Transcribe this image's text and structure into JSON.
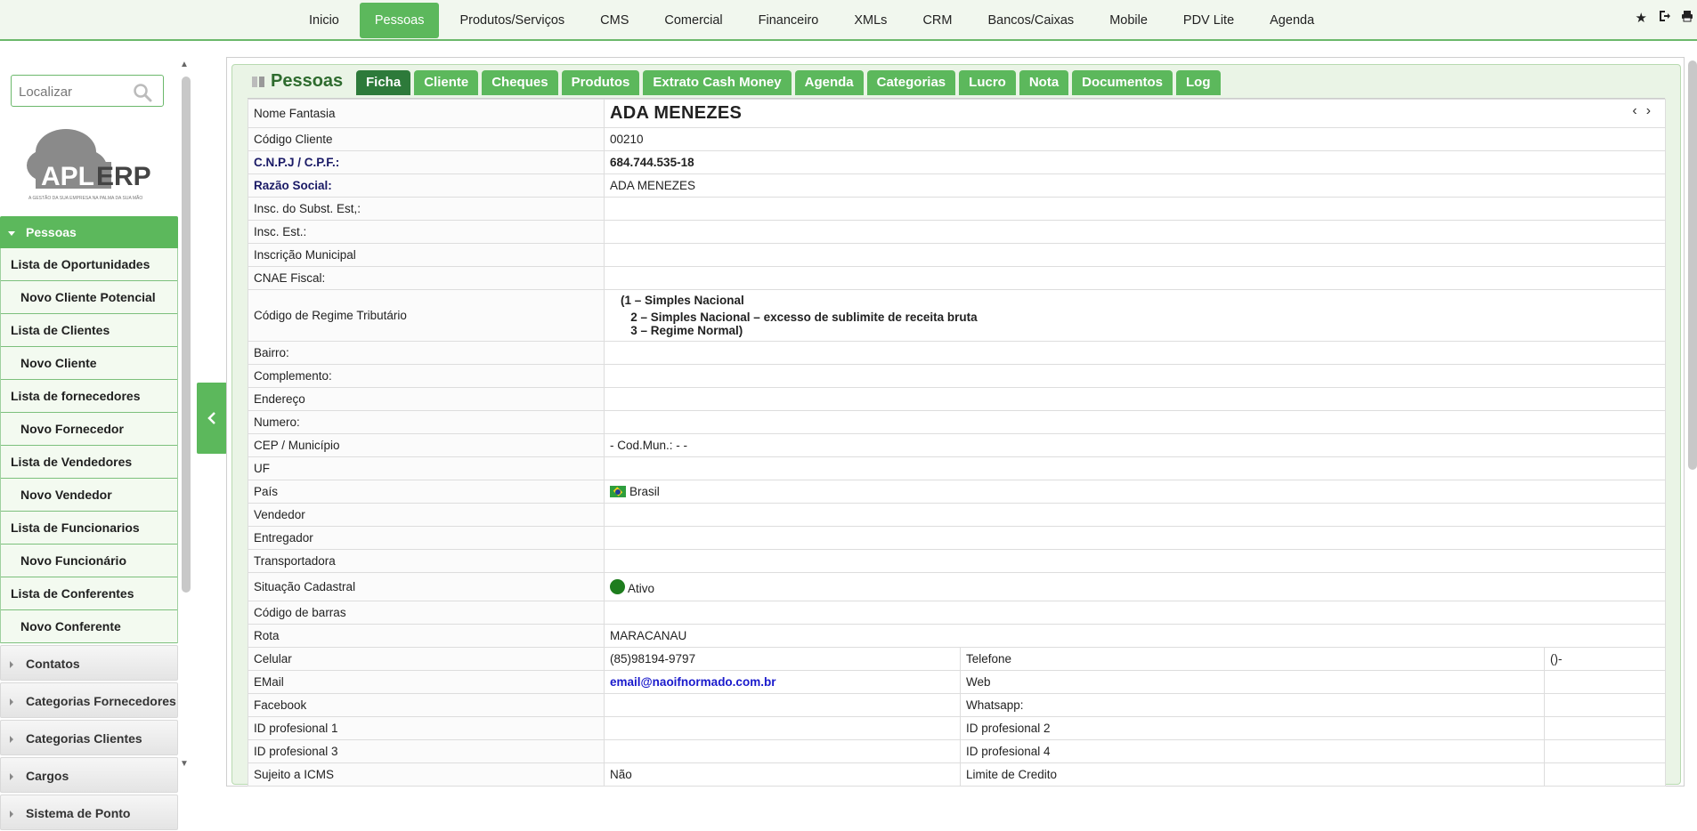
{
  "topmenu": {
    "items": [
      {
        "label": "Inicio"
      },
      {
        "label": "Pessoas",
        "active": true
      },
      {
        "label": "Produtos/Serviços"
      },
      {
        "label": "CMS"
      },
      {
        "label": "Comercial"
      },
      {
        "label": "Financeiro"
      },
      {
        "label": "XMLs"
      },
      {
        "label": "CRM"
      },
      {
        "label": "Bancos/Caixas"
      },
      {
        "label": "Mobile"
      },
      {
        "label": "PDV Lite"
      },
      {
        "label": "Agenda"
      }
    ],
    "icons": [
      "star-icon",
      "logout-icon",
      "print-icon"
    ]
  },
  "sidebar": {
    "search_placeholder": "Localizar",
    "logo_text": "APL ERP",
    "logo_tagline": "A GESTÃO DA SUA EMPRESA NA PALMA DA SUA MÃO",
    "active_section": "Pessoas",
    "items": [
      {
        "label": "Lista de Oportunidades",
        "indent": false
      },
      {
        "label": "Novo Cliente Potencial",
        "indent": true
      },
      {
        "label": "Lista de Clientes",
        "indent": false
      },
      {
        "label": "Novo Cliente",
        "indent": true
      },
      {
        "label": "Lista de fornecedores",
        "indent": false
      },
      {
        "label": "Novo Fornecedor",
        "indent": true
      },
      {
        "label": "Lista de Vendedores",
        "indent": false
      },
      {
        "label": "Novo Vendedor",
        "indent": true
      },
      {
        "label": "Lista de Funcionarios",
        "indent": false
      },
      {
        "label": "Novo Funcionário",
        "indent": true
      },
      {
        "label": "Lista de Conferentes",
        "indent": false
      },
      {
        "label": "Novo Conferente",
        "indent": true
      }
    ],
    "groups": [
      "Contatos",
      "Categorias Fornecedores",
      "Categorias Clientes",
      "Cargos",
      "Sistema de Ponto"
    ]
  },
  "panel": {
    "title": "Pessoas",
    "tabs": [
      {
        "label": "Ficha",
        "active": true
      },
      {
        "label": "Cliente"
      },
      {
        "label": "Cheques"
      },
      {
        "label": "Produtos"
      },
      {
        "label": "Extrato Cash Money"
      },
      {
        "label": "Agenda"
      },
      {
        "label": "Categorias"
      },
      {
        "label": "Lucro"
      },
      {
        "label": "Nota"
      },
      {
        "label": "Documentos"
      },
      {
        "label": "Log"
      }
    ]
  },
  "form": {
    "nome_fantasia_label": "Nome Fantasia",
    "nome_fantasia": "ADA MENEZES",
    "codigo_cliente_label": "Código Cliente",
    "codigo_cliente": "00210",
    "cnpj_label": "C.N.P.J / C.P.F.:",
    "cnpj": "684.744.535-18",
    "razao_label": "Razão Social:",
    "razao": "ADA MENEZES",
    "insc_subst_label": "Insc. do Subst. Est,:",
    "insc_est_label": "Insc. Est.:",
    "insc_mun_label": "Inscrição Municipal",
    "cnae_label": "CNAE Fiscal:",
    "regime_label": "Código de Regime Tributário",
    "regime_lines": [
      "(1 – Simples Nacional",
      "   2 – Simples Nacional – excesso de sublimite de receita bruta",
      "   3 – Regime Normal)"
    ],
    "bairro_label": "Bairro:",
    "complemento_label": "Complemento:",
    "endereco_label": "Endereço",
    "numero_label": "Numero:",
    "cep_label": "CEP / Município",
    "cep": "- Cod.Mun.: - -",
    "uf_label": "UF",
    "pais_label": "País",
    "pais": "Brasil",
    "vendedor_label": "Vendedor",
    "entregador_label": "Entregador",
    "transportadora_label": "Transportadora",
    "situacao_label": "Situação Cadastral",
    "situacao": "Ativo",
    "situacao_color": "#1e7d1e",
    "codigo_barras_label": "Código de barras",
    "rota_label": "Rota",
    "rota": "MARACANAU",
    "celular_label": "Celular",
    "celular": "(85)98194-9797",
    "telefone_label": "Telefone",
    "telefone": "()-",
    "email_label": "EMail",
    "email": "email@naoifnormado.com.br",
    "web_label": "Web",
    "facebook_label": "Facebook",
    "whatsapp_label": "Whatsapp:",
    "id_prof1_label": "ID profesional 1",
    "id_prof2_label": "ID profesional 2",
    "id_prof3_label": "ID profesional 3",
    "id_prof4_label": "ID profesional 4",
    "icms_label": "Sujeito a ICMS",
    "icms": "Não",
    "limite_label": "Limite de Credito"
  }
}
